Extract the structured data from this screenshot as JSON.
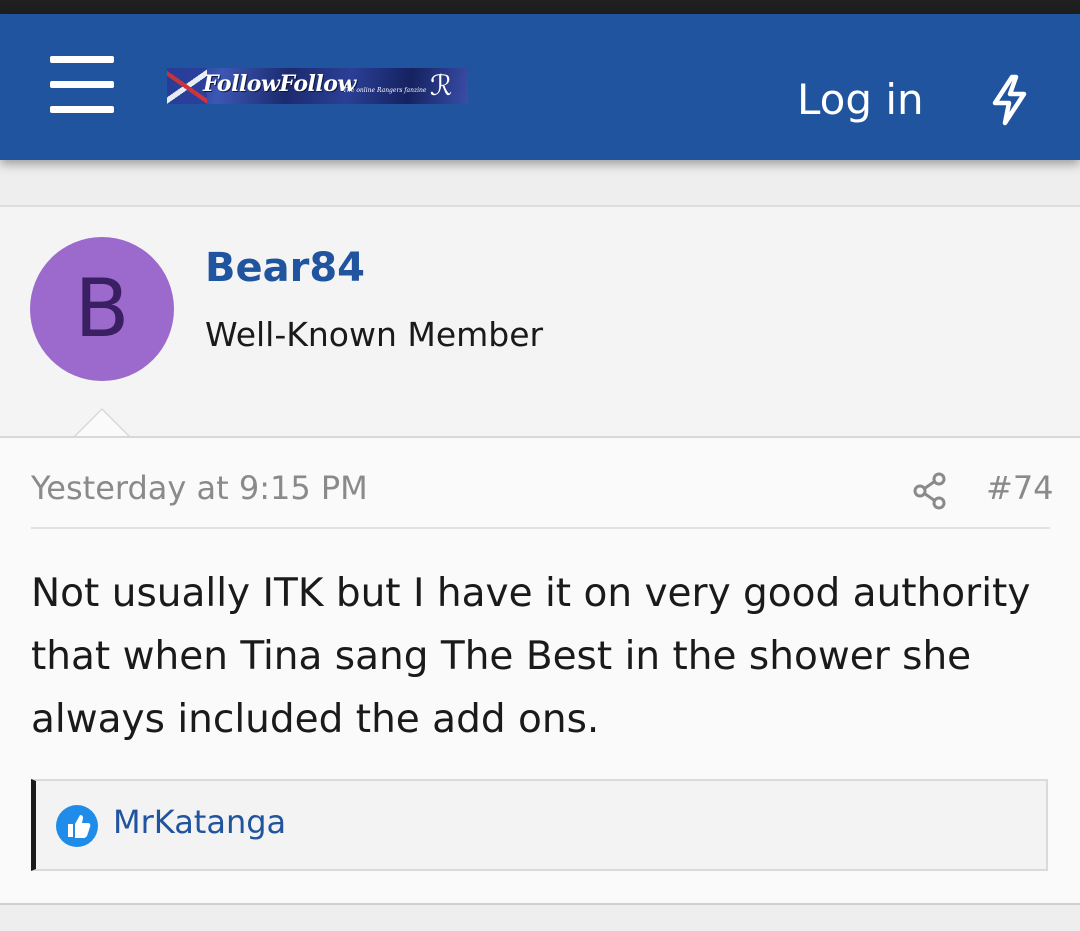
{
  "header": {
    "logo_text": "FollowFollow",
    "logo_tagline": "The online Rangers fanzine",
    "login_label": "Log in",
    "background_color": "#21549e"
  },
  "post": {
    "author": {
      "avatar_letter": "B",
      "avatar_color": "#9c6acc",
      "name": "Bear84",
      "title": "Well-Known Member"
    },
    "date": "Yesterday at 9:15 PM",
    "number": "#74",
    "body": "Not usually ITK but I have it on very good authority that when Tina sang The Best in the shower she always included the add ons.",
    "reactions": {
      "icon": "like-icon",
      "users": "MrKatanga"
    }
  },
  "icons": {
    "menu": "hamburger-menu-icon",
    "bolt": "bolt-icon",
    "share": "share-icon",
    "like": "thumbs-up-icon"
  }
}
